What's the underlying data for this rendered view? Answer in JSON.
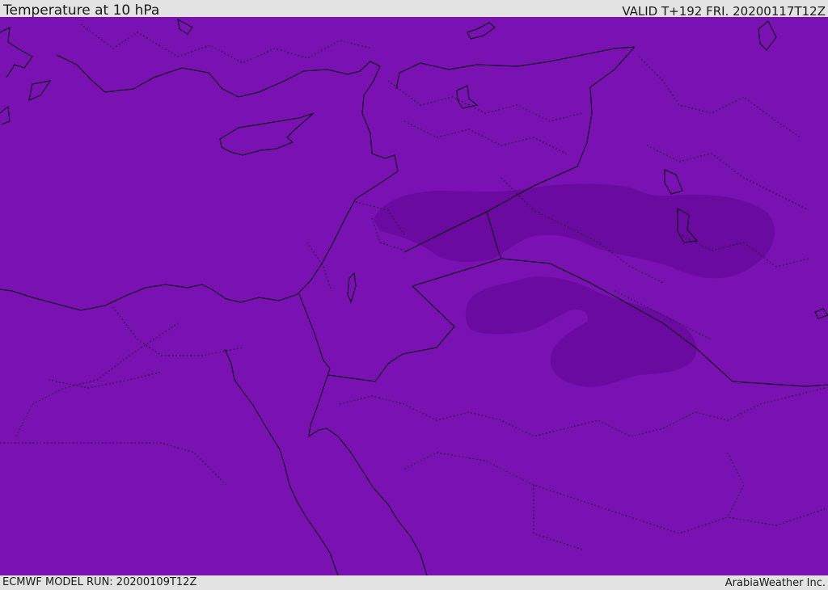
{
  "header": {
    "title": "Temperature at 10 hPa",
    "valid_time": "VALID T+192 FRI. 20200117T12Z"
  },
  "footer": {
    "model_run": "ECMWF MODEL RUN: 20200109T12Z",
    "credit": "ArabiaWeather Inc."
  },
  "map": {
    "fill_color": "#7a12b3",
    "cold_region_color": "#6a0aa0",
    "line_color": "#000000"
  }
}
